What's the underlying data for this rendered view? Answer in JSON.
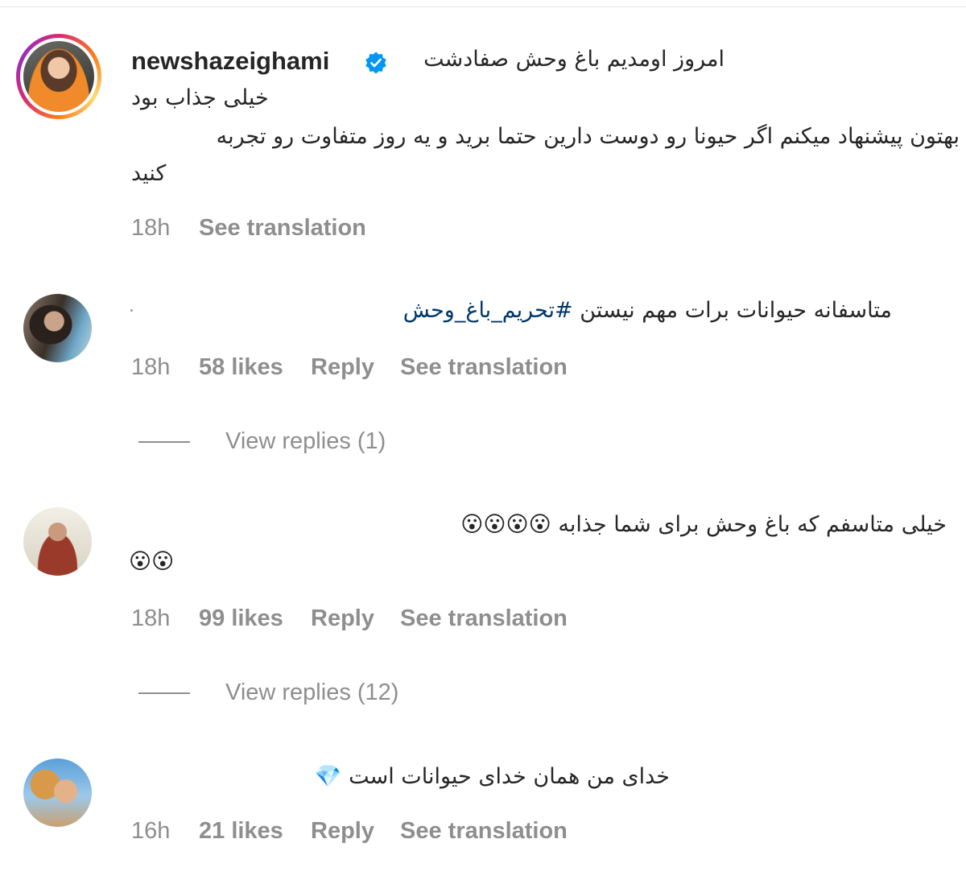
{
  "post": {
    "username": "newshazeighami",
    "verified_icon": "verified-badge-icon",
    "caption_line1": "امروز اومدیم باغ وحش صفادشت",
    "caption_line2": "خیلی جذاب بود",
    "caption_line3": "بهتون پیشنهاد میکنم اگر حیونا رو دوست دارین حتما برید و یه روز متفاوت رو تجربه",
    "caption_line4": "کنید",
    "caption_glyph": "",
    "time": "18h",
    "see_translation": "See translation"
  },
  "comments": [
    {
      "text": "متاسفانه حیوانات برات مهم نیستن ",
      "hashtag": "#تحریم_باغ_وحش",
      "time": "18h",
      "likes": "58 likes",
      "reply": "Reply",
      "see_translation": "See translation",
      "view_replies": "View replies (1)"
    },
    {
      "text_line1": "خیلی متاسفم که باغ وحش برای شما جذابه 😮😮😮😮",
      "text_line2": "😮😮",
      "time": "18h",
      "likes": "99 likes",
      "reply": "Reply",
      "see_translation": "See translation",
      "view_replies": "View replies (12)"
    },
    {
      "text": "خدای من همان خدای حیوانات است 💎",
      "time": "16h",
      "likes": "21 likes",
      "reply": "Reply",
      "see_translation": "See translation"
    }
  ],
  "colors": {
    "text": "#262626",
    "muted": "#8e8e8e",
    "hashtag": "#00376b",
    "verified": "#0095f6"
  }
}
